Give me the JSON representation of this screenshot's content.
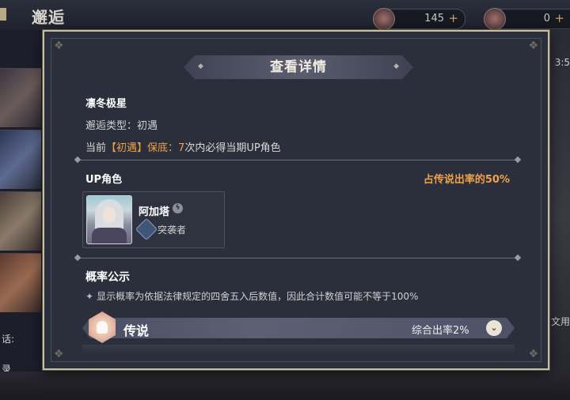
{
  "background": {
    "screen_title": "邂逅",
    "currency_a": {
      "icon": "compass-icon",
      "value": "145",
      "plus": "+"
    },
    "currency_b": {
      "icon": "crystal-icon",
      "value": "0",
      "plus": "+"
    },
    "right_partial_1": "3:5",
    "right_partial_2": "文用",
    "left_partial_1": "话:",
    "left_partial_2": "录"
  },
  "modal": {
    "title": "查看详情",
    "banner_name": "凛冬极星",
    "encounter_type_label": "邂逅类型：",
    "encounter_type_value": "初遇",
    "pity_prefix": "当前",
    "pity_banner": "【初遇】",
    "pity_label": "保底：",
    "pity_count": "7",
    "pity_suffix": "次内必得当期UP角色",
    "up_section": {
      "title": "UP角色",
      "rate_text": "占传说出率的50%",
      "character": {
        "name": "阿加塔",
        "element_icon": "lightning-element-icon",
        "class_icon": "assault-class-icon",
        "class_name": "突袭者"
      }
    },
    "probability": {
      "title": "概率公示",
      "note": "显示概率为依据法律规定的四舍五入后数值，因此合计数值可能不等于100%",
      "tiers": [
        {
          "label": "传说",
          "rate": "综合出率2%",
          "icon": "legend-emblem-icon"
        }
      ]
    }
  },
  "colors": {
    "accent_orange": "#f0a24a",
    "modal_bg": "#2b2f3b",
    "modal_border": "#c8bea4"
  }
}
